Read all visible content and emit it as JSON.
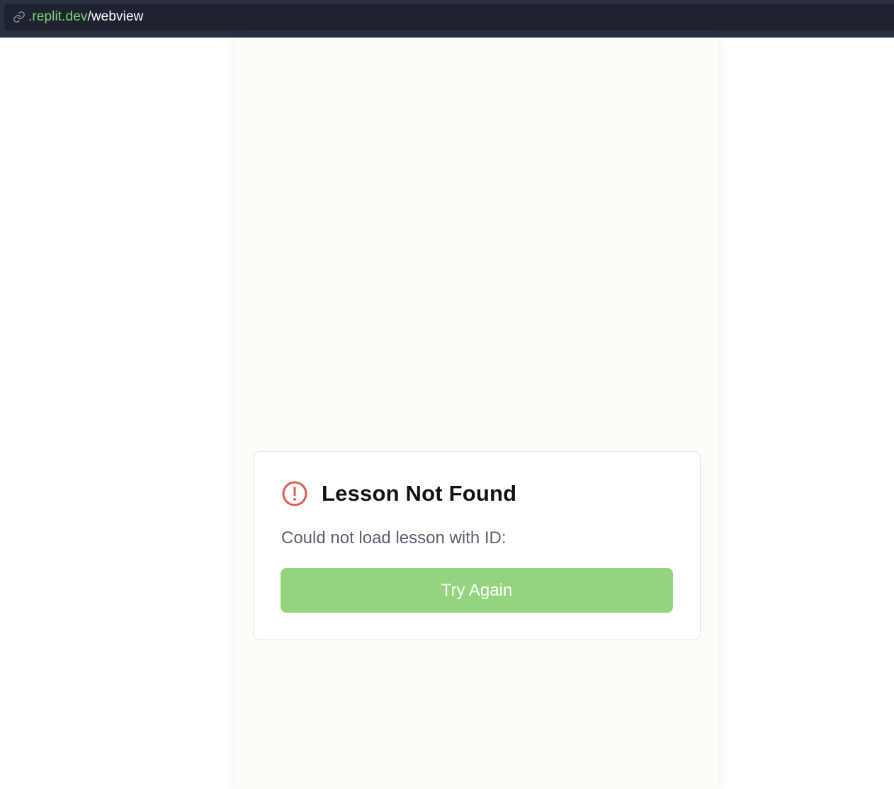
{
  "address_bar": {
    "icon": "link-icon",
    "host": ".replit.dev",
    "path": "/webview",
    "host_color": "#7fd47a"
  },
  "error_card": {
    "icon": "alert-circle-icon",
    "icon_color": "#e05a55",
    "title": "Lesson Not Found",
    "message": "Could not load lesson with ID:",
    "retry_label": "Try Again",
    "button_color": "#94d47f"
  }
}
